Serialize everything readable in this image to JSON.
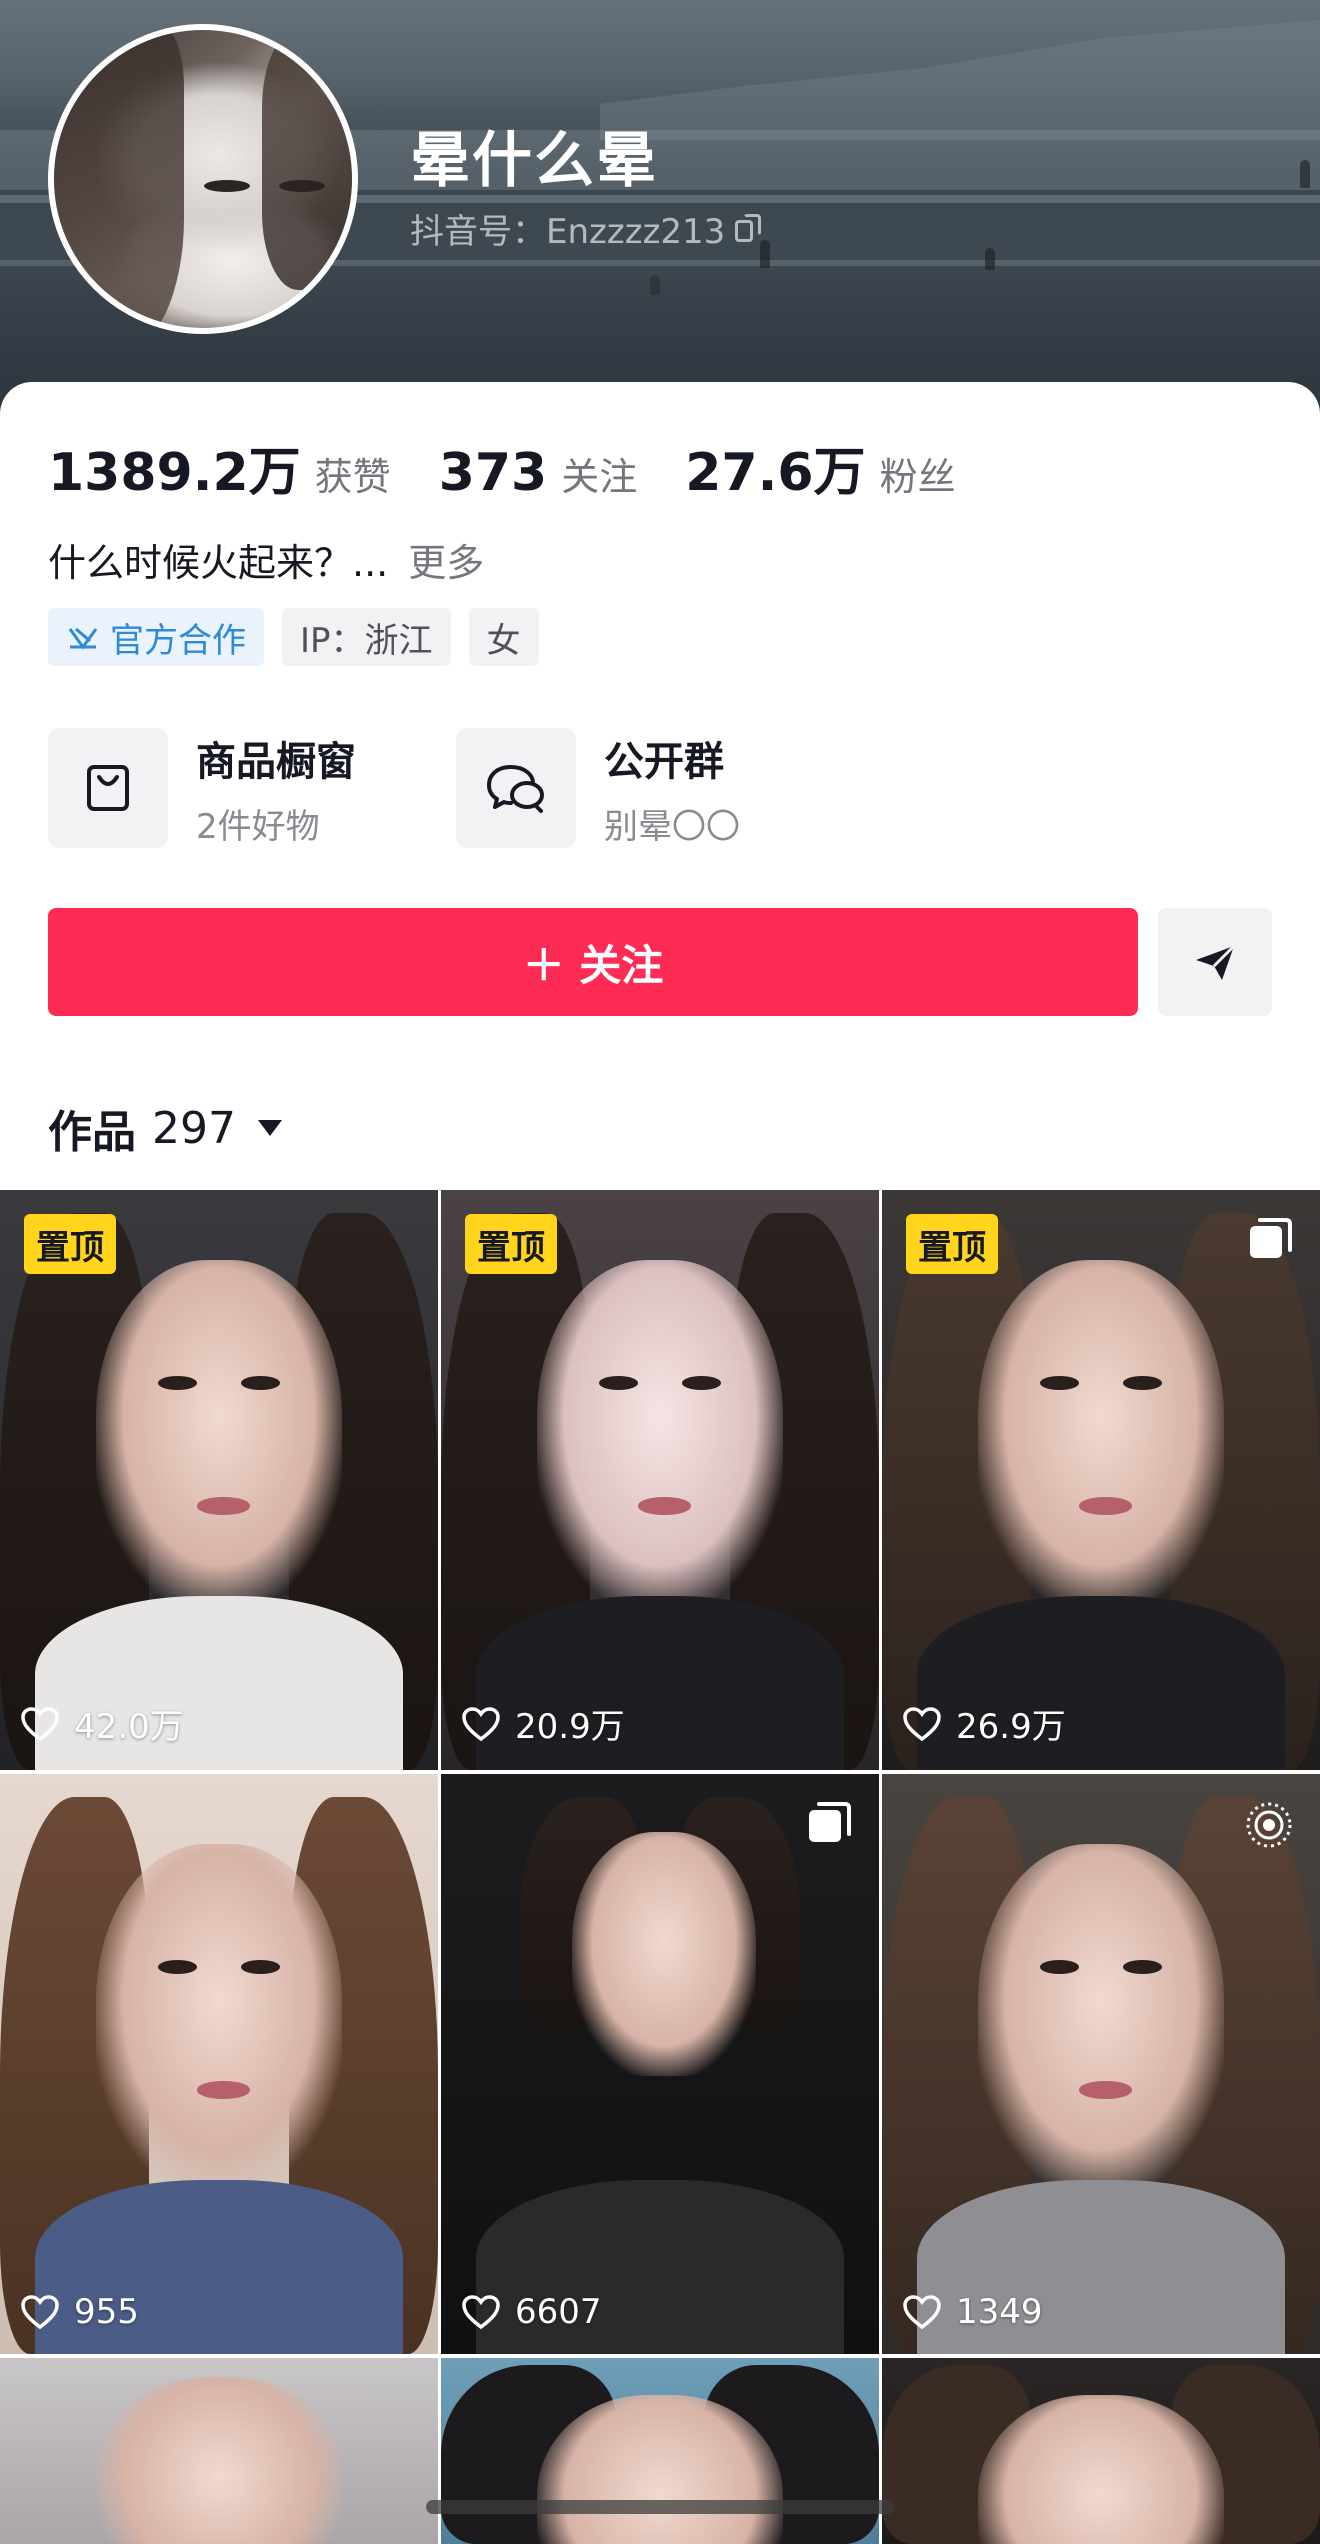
{
  "profile": {
    "nickname": "晕什么晕",
    "douyin_id": "抖音号：Enzzzz213"
  },
  "stats": [
    {
      "value": "1389.2万",
      "label": "获赞"
    },
    {
      "value": "373",
      "label": "关注"
    },
    {
      "value": "27.6万",
      "label": "粉丝"
    }
  ],
  "bio": {
    "text": "什么时候火起来？...",
    "more": "更多"
  },
  "tags": {
    "official": "官方合作",
    "ip": "IP：浙江",
    "gender": "女"
  },
  "features": {
    "shop": {
      "title": "商品橱窗",
      "subtitle": "2件好物"
    },
    "group": {
      "title": "公开群",
      "subtitle": "别晕〇〇"
    }
  },
  "actions": {
    "follow": "＋ 关注",
    "accent": "#fe2c55"
  },
  "works": {
    "label": "作品",
    "count": "297"
  },
  "posts": [
    {
      "pinned": "置顶",
      "likes": "42.0万"
    },
    {
      "pinned": "置顶",
      "likes": "20.9万"
    },
    {
      "pinned": "置顶",
      "likes": "26.9万",
      "icon": "multi-image-icon"
    },
    {
      "likes": "955"
    },
    {
      "likes": "6607",
      "icon": "multi-image-icon"
    },
    {
      "likes": "1349",
      "icon": "live-photo-icon"
    },
    {},
    {},
    {}
  ],
  "colors": {
    "pin_badge": "#ffd41a",
    "official_tag": "#2c8ad8"
  }
}
